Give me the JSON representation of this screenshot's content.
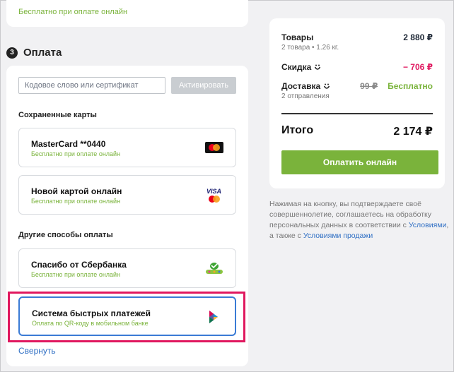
{
  "delivery_card": {
    "note": "Бесплатно при оплате онлайн"
  },
  "payment": {
    "step": "3",
    "title": "Оплата",
    "promo": {
      "placeholder": "Кодовое слово или сертификат",
      "activate_label": "Активировать"
    },
    "saved_cards_label": "Сохраненные карты",
    "saved_cards": [
      {
        "name": "MasterCard **0440",
        "sub": "Бесплатно при оплате онлайн",
        "icon": "mastercard-icon"
      },
      {
        "name": "Новой картой онлайн",
        "sub": "Бесплатно при оплате онлайн",
        "icon": "visa-mastercard-icon"
      }
    ],
    "other_label": "Другие способы оплаты",
    "other_methods": [
      {
        "name": "Спасибо от Сбербанка",
        "sub": "Бесплатно при оплате онлайн",
        "icon": "sberbank-spasibo-icon"
      },
      {
        "name": "Система быстрых платежей",
        "sub": "Оплата по QR-коду в мобильном банке",
        "icon": "sbp-icon",
        "selected": true
      }
    ],
    "collapse_label": "Свернуть"
  },
  "summary": {
    "goods_label": "Товары",
    "goods_sub": "2 товара • 1.26 кг.",
    "goods_value": "2 880 ₽",
    "discount_label": "Скидка",
    "discount_value": "− 706 ₽",
    "delivery_label": "Доставка",
    "delivery_sub": "2 отправления",
    "delivery_old": "99 ₽",
    "delivery_value": "Бесплатно",
    "total_label": "Итого",
    "total_value": "2 174 ₽",
    "pay_button": "Оплатить онлайн"
  },
  "disclaimer": {
    "text": "Нажимая на кнопку, вы подтверждаете своё совершеннолетие, соглашаетесь на обработку персональных данных в соответствии с",
    "link1": "Условиями",
    "middle": ", а также с",
    "link2": "Условиями продажи"
  },
  "colors": {
    "accent_green": "#7ab33b",
    "discount_red": "#e0185f",
    "link_blue": "#2f6fc4",
    "highlight": "#e0185f"
  }
}
